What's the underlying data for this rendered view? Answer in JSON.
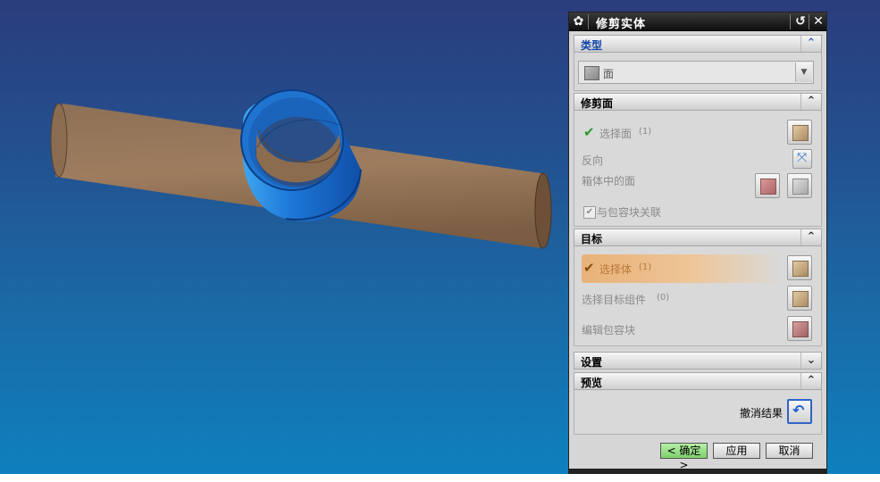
{
  "dialog": {
    "title": "修剪实体",
    "sections": {
      "type": {
        "header": "类型",
        "combo_value": "面"
      },
      "trim_face": {
        "header": "修剪面",
        "select_face": "选择面",
        "select_face_count": "(1)",
        "reverse": "反向",
        "face_in_box": "箱体中的面",
        "associate_box": "与包容块关联",
        "associate_box_checked": true
      },
      "target": {
        "header": "目标",
        "select_body": "选择体",
        "select_body_count": "(1)",
        "select_target_component": "选择目标组件",
        "select_target_component_count": "(0)",
        "edit_box": "编辑包容块"
      },
      "settings": {
        "header": "设置"
      },
      "preview": {
        "header": "预览",
        "undo_result": "撤消结果"
      }
    },
    "buttons": {
      "ok": "< 确定 >",
      "apply": "应用",
      "cancel": "取消"
    }
  },
  "colors": {
    "pipe": "#8a6a4c",
    "collar": "#1e78d8",
    "check_green": "#2c9a32",
    "check_orange": "#8a4a10"
  },
  "icons": [
    "gear-icon",
    "reset-icon",
    "close-icon",
    "chevron-up-icon",
    "chevron-down-icon",
    "face-type-icon",
    "select-face-icon",
    "reverse-direction-icon",
    "box-face-icon",
    "box-edit-icon",
    "select-body-icon",
    "select-component-icon",
    "edit-box-icon",
    "undo-icon",
    "check-icon"
  ]
}
